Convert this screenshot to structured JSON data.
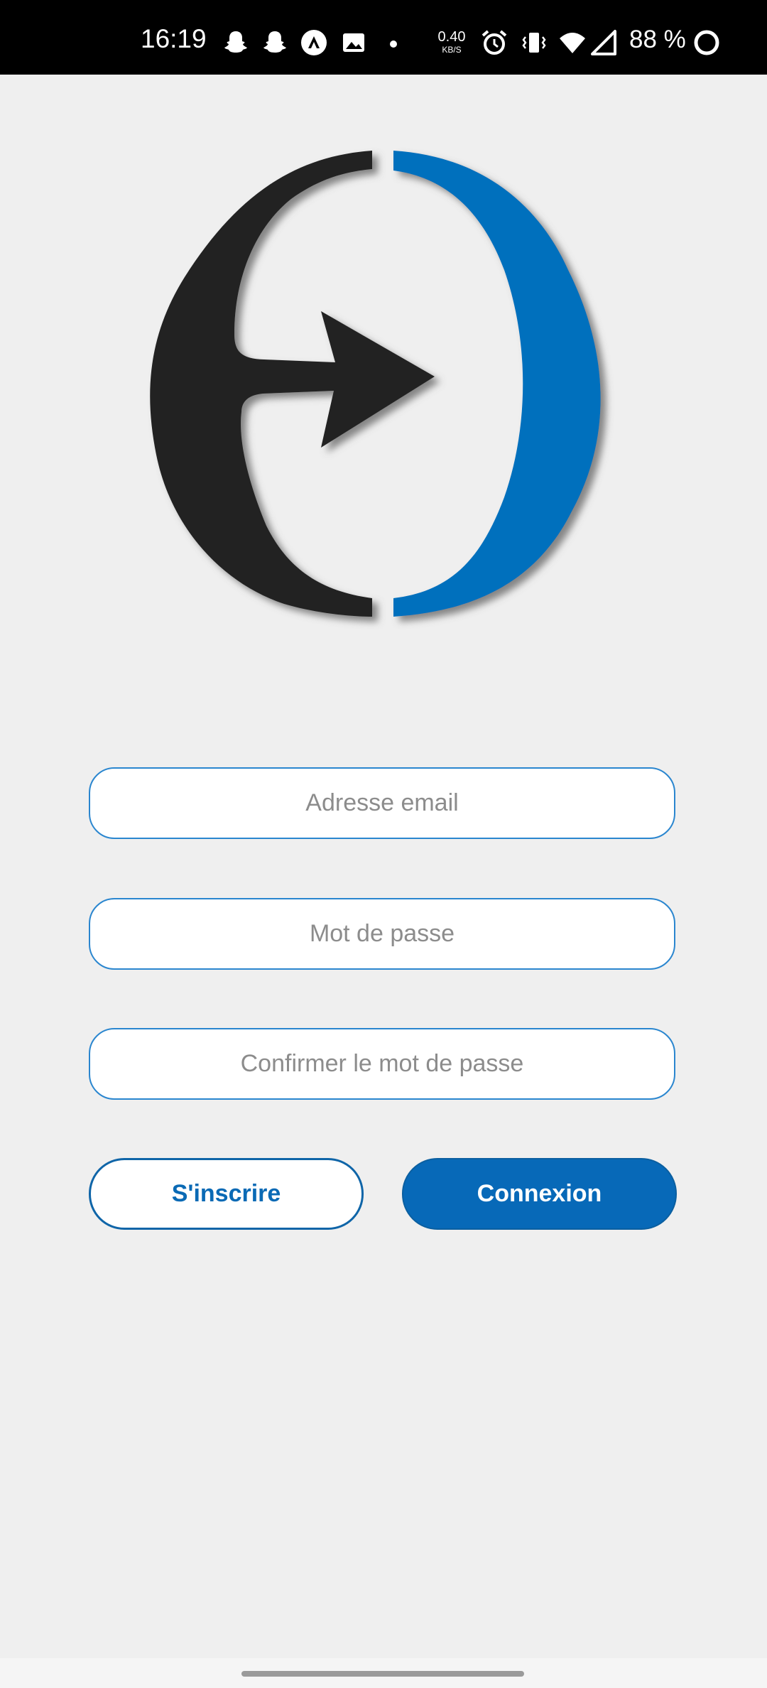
{
  "status_bar": {
    "time": "16:19",
    "network_speed_value": "0.40",
    "network_speed_unit": "KB/S",
    "battery_percent": "88 %",
    "icons": [
      "snapchat-icon",
      "snapchat-icon",
      "app-icon",
      "image-icon",
      "dot-icon",
      "alarm-icon",
      "vibrate-icon",
      "wifi-icon",
      "signal-icon",
      "battery-ring-icon"
    ]
  },
  "logo": {
    "colors": {
      "left": "#222222",
      "right": "#0570bd",
      "shadow": "#6b6b6b"
    }
  },
  "form": {
    "email_placeholder": "Adresse email",
    "password_placeholder": "Mot de passe",
    "confirm_placeholder": "Confirmer le mot de passe",
    "email_value": "",
    "password_value": "",
    "confirm_value": ""
  },
  "buttons": {
    "signup_label": "S'inscrire",
    "login_label": "Connexion"
  },
  "colors": {
    "background": "#efefef",
    "accent": "#0769b8",
    "field_border": "#2a86cf"
  }
}
